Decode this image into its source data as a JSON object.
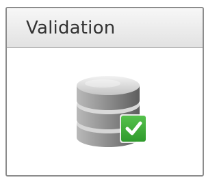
{
  "tile": {
    "title": "Validation",
    "icon": "database-validated-icon",
    "badge_icon": "checkmark-icon",
    "colors": {
      "badge": "#3aa635",
      "database": "#8e8e8e",
      "header_bg": "#eaeaea"
    }
  }
}
